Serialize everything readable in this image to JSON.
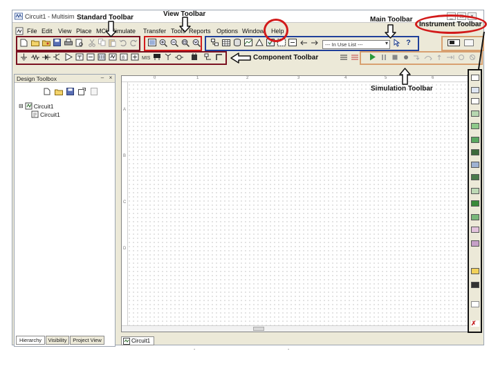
{
  "window": {
    "title": "Circuit1 - Multisim",
    "controls": [
      "_",
      "□",
      "×"
    ]
  },
  "menu": {
    "items": [
      "File",
      "Edit",
      "View",
      "Place",
      "MCU",
      "Simulate",
      "Transfer",
      "Tools",
      "Reports",
      "Options",
      "Window",
      "Help"
    ]
  },
  "main_toolbar": {
    "in_use_list": "--- In Use List ---",
    "help_glyph": "?"
  },
  "annotations": {
    "standard_toolbar": "Standard Toolbar",
    "view_toolbar": "View Toolbar",
    "main_toolbar": "Main Toolbar",
    "instrument_toolbar": "Instrument Toolbar",
    "component_toolbar": "Component Toolbar",
    "simulation_toolbar": "Simulation Toolbar",
    "colors": {
      "standard": "#7a1020",
      "view": "#d21a1a",
      "main": "#1f3f9a",
      "component": "#7a1020",
      "simulation": "#d8a070",
      "instrument": "#d21a1a",
      "help_circle": "#d21a1a"
    }
  },
  "design_toolbox": {
    "title": "Design Toolbox",
    "tree": {
      "root": "Circuit1",
      "child": "Circuit1"
    },
    "tabs": [
      "Hierarchy",
      "Visibility",
      "Project View"
    ]
  },
  "workspace": {
    "ruler_numbers": [
      "0",
      "1",
      "2",
      "3",
      "4",
      "5",
      "6"
    ],
    "row_letters": [
      "A",
      "B",
      "C",
      "D"
    ],
    "document_tab": "Circuit1"
  }
}
